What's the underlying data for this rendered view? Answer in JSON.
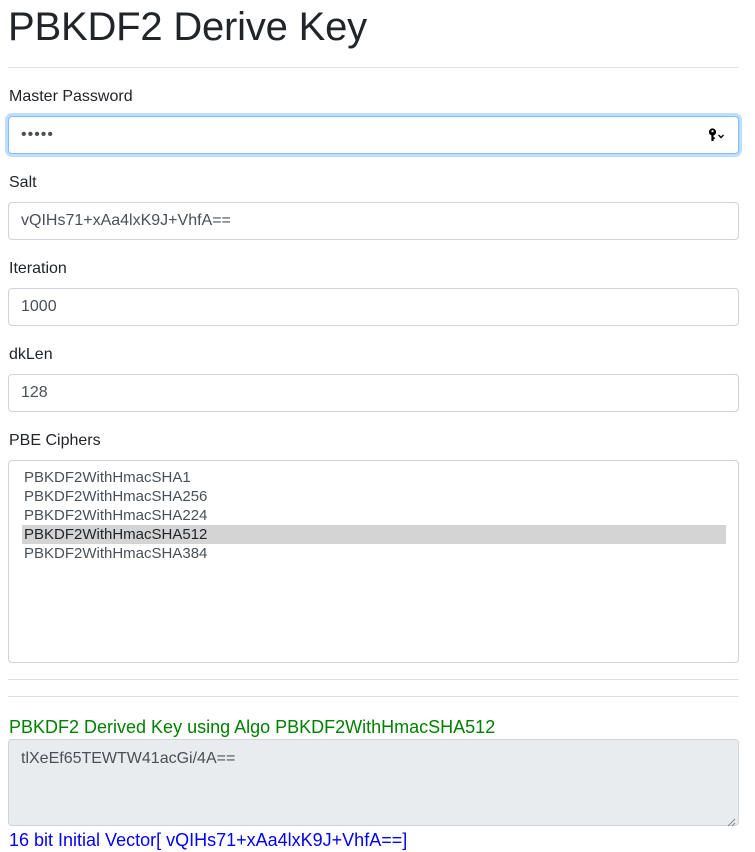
{
  "page": {
    "title": "PBKDF2 Derive Key"
  },
  "form": {
    "password": {
      "label": "Master Password",
      "masked_value": "•••••",
      "icon": "key-icon"
    },
    "salt": {
      "label": "Salt",
      "value": "vQIHs71+xAa4lxK9J+VhfA=="
    },
    "iteration": {
      "label": "Iteration",
      "value": "1000"
    },
    "dklen": {
      "label": "dkLen",
      "value": "128"
    },
    "ciphers": {
      "label": "PBE Ciphers",
      "options": [
        "PBKDF2WithHmacSHA1",
        "PBKDF2WithHmacSHA256",
        "PBKDF2WithHmacSHA224",
        "PBKDF2WithHmacSHA512",
        "PBKDF2WithHmacSHA384"
      ],
      "selected_index": 3
    }
  },
  "result": {
    "heading": "PBKDF2 Derived Key using Algo PBKDF2WithHmacSHA512",
    "derived_key": "tlXeEf65TEWTW41acGi/4A==",
    "iv_text": "16 bit Initial Vector[ vQIHs71+xAa4lxK9J+VhfA==]"
  },
  "colors": {
    "heading_green": "#008000",
    "iv_blue": "#0000ff",
    "focus_border": "#80bdff",
    "selected_option_bg": "#d4d4d4"
  }
}
